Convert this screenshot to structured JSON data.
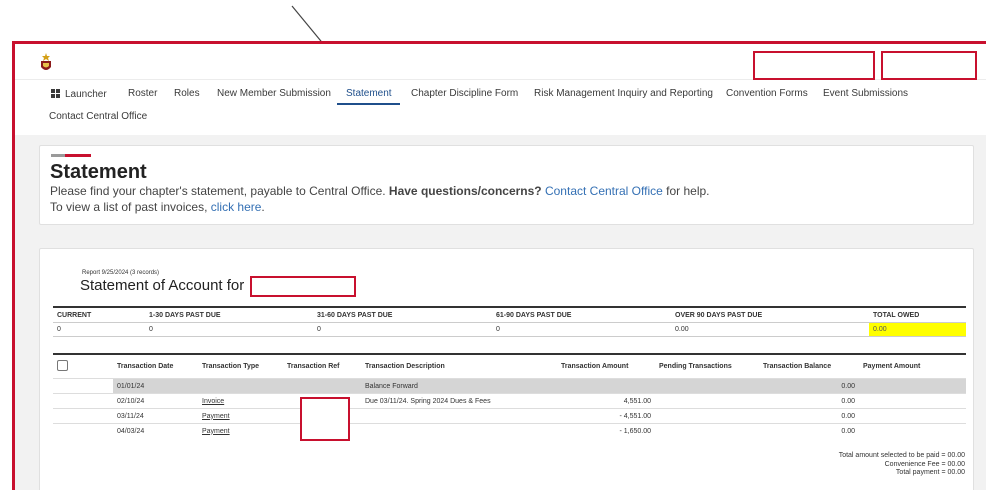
{
  "nav": {
    "items": [
      "Launcher",
      "Roster",
      "Roles",
      "New Member Submission",
      "Statement",
      "Chapter Discipline Form",
      "Risk Management Inquiry and Reporting",
      "Convention Forms",
      "Event Submissions"
    ],
    "row2": [
      "Contact Central Office"
    ],
    "active": "Statement"
  },
  "statement": {
    "title": "Statement",
    "line1_pre": "Please find your chapter's statement, payable to Central Office. ",
    "line1_bold": "Have questions/concerns? ",
    "line1_link": "Contact Central Office",
    "line1_post": " for help.",
    "line2_pre": "To view a list of past invoices, ",
    "line2_link": "click here",
    "line2_post": "."
  },
  "report": {
    "small": "Report 9/25/2024 (3 records)",
    "title": "Statement of Account for"
  },
  "aging": {
    "headers": [
      "CURRENT",
      "1-30 DAYS PAST DUE",
      "31-60 DAYS PAST DUE",
      "61-90 DAYS PAST DUE",
      "OVER 90 DAYS PAST DUE",
      "TOTAL OWED"
    ],
    "values": [
      "0",
      "0",
      "0",
      "0",
      "0.00",
      "0.00"
    ]
  },
  "transactions": {
    "headers": [
      "Transaction Date",
      "Transaction Type",
      "Transaction Ref",
      "Transaction Description",
      "Transaction Amount",
      "Pending Transactions",
      "Transaction Balance",
      "Payment Amount"
    ],
    "rows": [
      {
        "date": "01/01/24",
        "type": "",
        "ref": "",
        "desc": "Balance Forward",
        "amount": "",
        "pending": "",
        "balance": "0.00",
        "payment": ""
      },
      {
        "date": "02/10/24",
        "type": "Invoice",
        "ref": "",
        "desc": "Due 03/11/24. Spring 2024 Dues & Fees",
        "amount": "4,551.00",
        "pending": "",
        "balance": "0.00",
        "payment": ""
      },
      {
        "date": "03/11/24",
        "type": "Payment",
        "ref": "",
        "desc": "",
        "amount": "- 4,551.00",
        "pending": "",
        "balance": "0.00",
        "payment": ""
      },
      {
        "date": "04/03/24",
        "type": "Payment",
        "ref": "",
        "desc": "",
        "amount": "- 1,650.00",
        "pending": "",
        "balance": "0.00",
        "payment": ""
      }
    ]
  },
  "totals": {
    "selected": "Total amount selected to be paid = 00.00",
    "fee": "Convenience Fee = 00.00",
    "payment": "Total payment = 00.00"
  },
  "colors": {
    "accent": "#c8102e",
    "link": "#3470b4",
    "highlight": "#ffff00",
    "active_tab": "#1f4f8b"
  }
}
